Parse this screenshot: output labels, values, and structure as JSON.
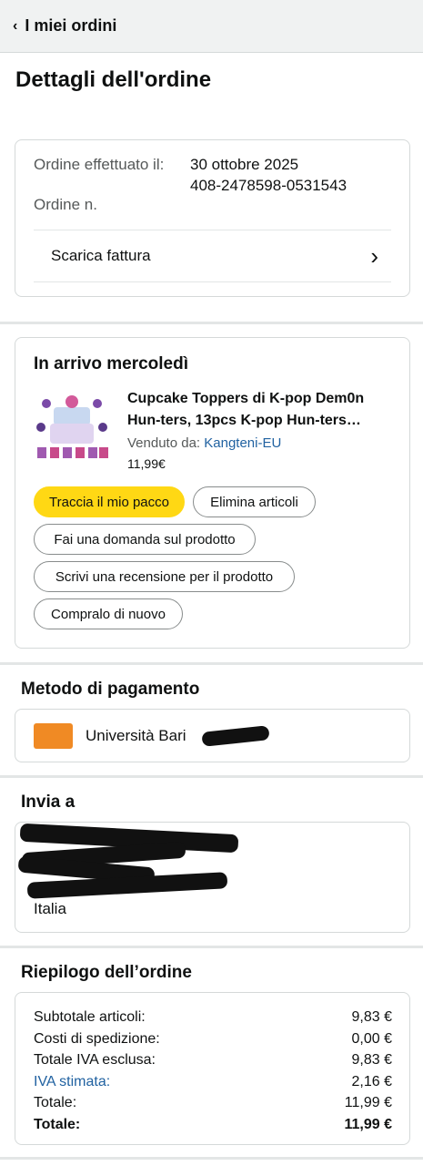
{
  "topbar": {
    "back_label": "I miei ordini"
  },
  "page_title": "Dettagli dell'ordine",
  "order_info": {
    "placed_label": "Ordine effettuato il:",
    "placed_value": "30 ottobre 2025",
    "number_label": "Ordine n.",
    "number_value": "408-2478598-0531543",
    "invoice_label": "Scarica fattura"
  },
  "shipment": {
    "status": "In arrivo mercoledì",
    "product_title_line1": "Cupcake Toppers di K-pop Dem0n",
    "product_title_line2": "Hun-ters, 13pcs K-pop Hun-ters…",
    "sold_by_label": "Venduto da:",
    "seller": "Kangteni-EU",
    "price": "11,99€",
    "buttons": {
      "track": "Traccia il mio pacco",
      "delete": "Elimina articoli",
      "ask": "Fai una domanda sul prodotto",
      "review": "Scrivi una recensione per il prodotto",
      "rebuy": "Compralo di nuovo"
    }
  },
  "payment": {
    "title": "Metodo di pagamento",
    "card_name": "Università Bari"
  },
  "shipping": {
    "title": "Invia a",
    "country": "Italia"
  },
  "summary": {
    "title": "Riepilogo dell’ordine",
    "rows": [
      {
        "label": "Subtotale articoli:",
        "value": "9,83 €"
      },
      {
        "label": "Costi di spedizione:",
        "value": "0,00 €"
      },
      {
        "label": "Totale IVA esclusa:",
        "value": "9,83 €"
      },
      {
        "label": "IVA stimata:",
        "value": "2,16 €"
      },
      {
        "label": "Totale:",
        "value": "11,99 €"
      },
      {
        "label": "Totale:",
        "value": "11,99 €"
      }
    ]
  },
  "colors": {
    "primary_button": "#ffd814",
    "link": "#2162a1",
    "card_logo": "#f08a24"
  }
}
